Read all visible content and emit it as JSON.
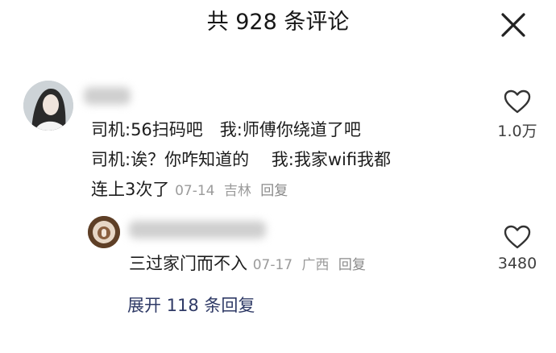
{
  "header": {
    "title": "共 928 条评论",
    "close_icon": "close-icon"
  },
  "comment": {
    "lines": [
      "司机:56扫码吧　我:师傅你绕道了吧",
      "司机:诶？你咋知道的　 我:我家wifi我都",
      "连上3次了"
    ],
    "date": "07-14",
    "location": "吉林",
    "reply_label": "回复",
    "likes": "1.0万"
  },
  "reply": {
    "text": "三过家门而不入",
    "date": "07-17",
    "location": "广西",
    "reply_label": "回复",
    "likes": "3480"
  },
  "expand_label": "展开 118 条回复",
  "colors": {
    "text": "#1d1d1d",
    "meta": "#9b9b9b",
    "expand": "#2f3a66",
    "icon": "#333333"
  }
}
